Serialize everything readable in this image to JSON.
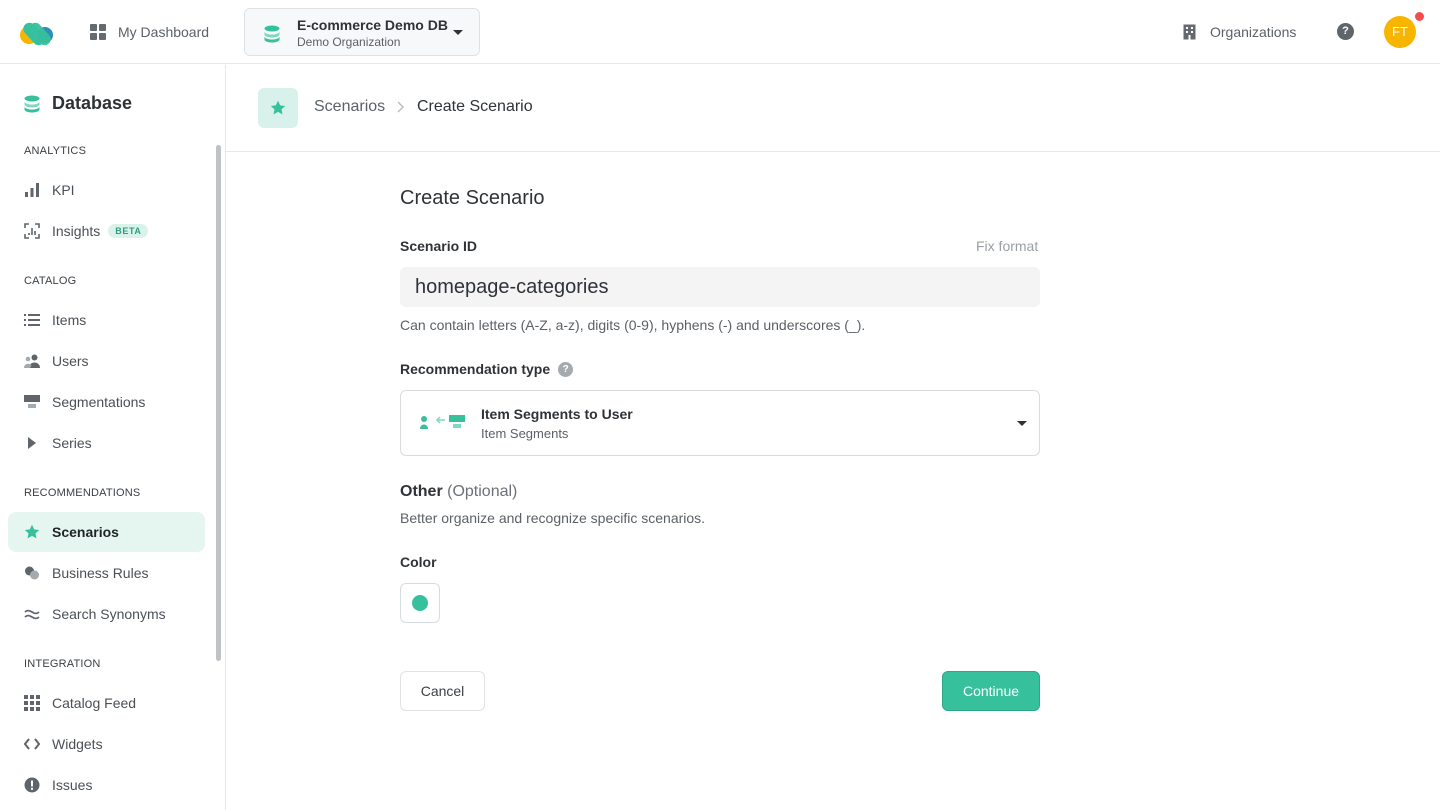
{
  "topbar": {
    "dashboard_label": "My Dashboard",
    "db_name": "E-commerce Demo DB",
    "db_org": "Demo Organization",
    "organizations_label": "Organizations",
    "help_glyph": "?",
    "avatar_initials": "FT",
    "avatar_color": "#f7b500",
    "notification_color": "#f24e4e"
  },
  "sidebar": {
    "title": "Database",
    "sections": {
      "analytics": "ANALYTICS",
      "catalog": "CATALOG",
      "recommendations": "RECOMMENDATIONS",
      "integration": "INTEGRATION"
    },
    "items": {
      "kpi": "KPI",
      "insights": "Insights",
      "insights_badge": "BETA",
      "items": "Items",
      "users": "Users",
      "segmentations": "Segmentations",
      "series": "Series",
      "scenarios": "Scenarios",
      "business_rules": "Business Rules",
      "search_synonyms": "Search Synonyms",
      "catalog_feed": "Catalog Feed",
      "widgets": "Widgets",
      "issues": "Issues"
    },
    "active_item": "Scenarios"
  },
  "breadcrumb": {
    "parent": "Scenarios",
    "current": "Create Scenario"
  },
  "form": {
    "title": "Create Scenario",
    "scenario_id_label": "Scenario ID",
    "fix_format_label": "Fix format",
    "scenario_id_value": "homepage-categories",
    "scenario_id_hint": "Can contain letters (A-Z, a-z), digits (0-9), hyphens (-) and underscores (_).",
    "recommendation_type_label": "Recommendation type",
    "recommendation_type_title": "Item Segments to User",
    "recommendation_type_subtitle": "Item Segments",
    "other_label": "Other",
    "other_optional": "(Optional)",
    "other_description": "Better organize and recognize specific scenarios.",
    "color_label": "Color",
    "color_value": "#37c09c",
    "cancel_label": "Cancel",
    "continue_label": "Continue"
  },
  "colors": {
    "accent": "#37c09c",
    "active_bg": "#e5f6f1"
  }
}
